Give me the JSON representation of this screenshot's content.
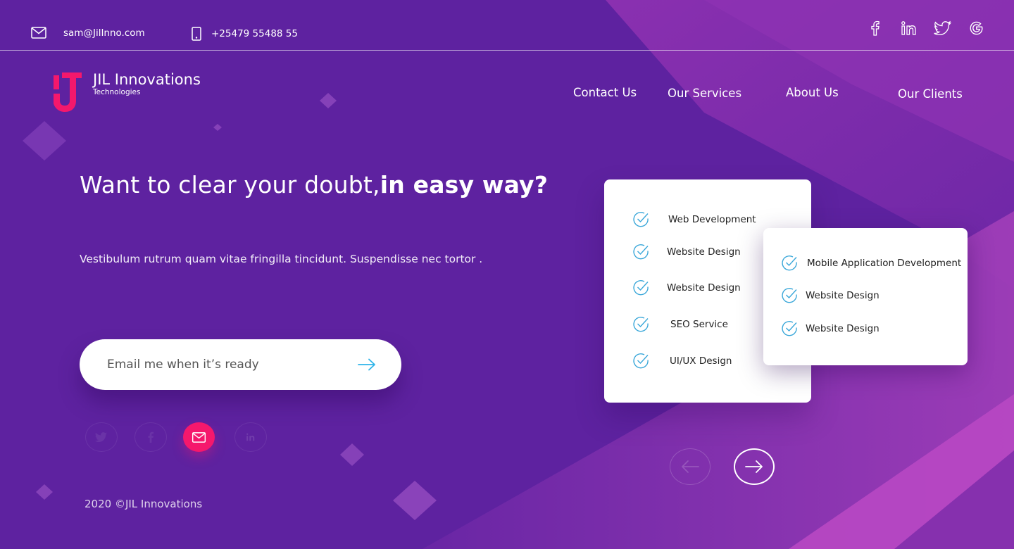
{
  "topbar": {
    "email": "sam@JilInno.com",
    "phone": "+25479 55488 55",
    "social": [
      "facebook-icon",
      "linkedin-icon",
      "twitter-icon",
      "google-icon"
    ]
  },
  "logo": {
    "name": "JIL Innovations",
    "tagline": "Technologies"
  },
  "nav": {
    "items": [
      {
        "label": "Contact Us"
      },
      {
        "label": "Our Services"
      },
      {
        "label": "About Us"
      },
      {
        "label": "Our Clients"
      }
    ]
  },
  "hero": {
    "title_regular": "Want to clear your doubt,",
    "title_bold": "in easy way?",
    "subtitle": "Vestibulum rutrum quam vitae fringilla tincidunt. Suspendisse nec tortor ."
  },
  "subscribe": {
    "placeholder": "Email me when it’s ready"
  },
  "social_row": [
    "twitter-icon",
    "facebook-icon",
    "mail-icon",
    "linkedin-icon"
  ],
  "services_card_1": [
    "Web Development",
    "Website Design",
    "Website Design",
    "SEO Service",
    "UI/UX Design"
  ],
  "services_card_2": [
    "Mobile Application Development",
    "Website Design",
    "Website Design"
  ],
  "footer": {
    "copyright": "2020 ©JIL Innovations"
  },
  "colors": {
    "background": "#5e22a0",
    "accent_pink": "#f5186c",
    "check_blue": "#3aa7d9",
    "arrow_blue": "#2fb4e9"
  }
}
